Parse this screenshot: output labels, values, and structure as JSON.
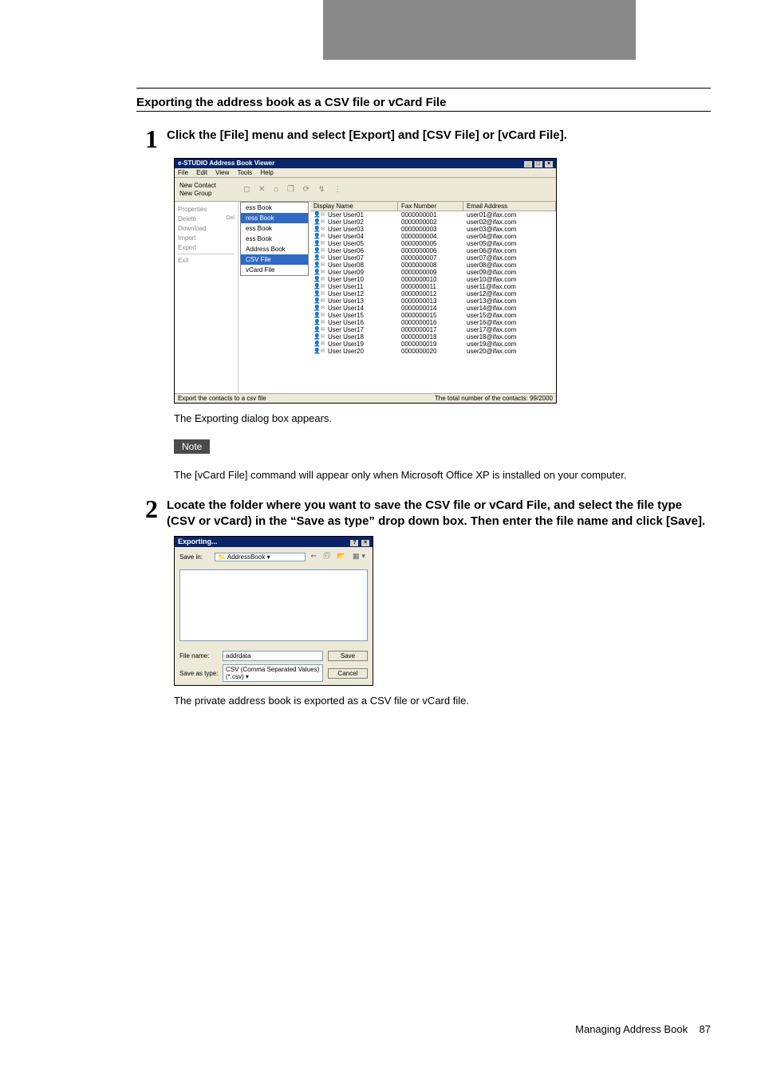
{
  "section_title": "Exporting the address book as a CSV file or vCard File",
  "steps": {
    "s1": {
      "num": "1",
      "text": "Click the [File] menu and select [Export] and [CSV File] or [vCard File]."
    },
    "s2": {
      "num": "2",
      "text": "Locate the folder where you want to save the CSV file or vCard File, and select the file type (CSV or vCard) in the “Save as type” drop down box. Then enter the file name and click [Save]."
    }
  },
  "caption1": "The Exporting dialog box appears.",
  "note_label": "Note",
  "note_text": "The [vCard File] command will appear only when Microsoft Office XP is installed on your computer.",
  "caption2": "The private address book is exported as a CSV file or vCard file.",
  "footer": {
    "title": "Managing Address Book",
    "page": "87"
  },
  "abviewer": {
    "title": "e-STUDIO Address Book Viewer",
    "menu": [
      "File",
      "Edit",
      "View",
      "Tools",
      "Help"
    ],
    "sidebuttons": [
      "New Contact",
      "New Group"
    ],
    "filemenu": {
      "items": [
        "Properties",
        "Delete",
        "Download",
        "Import",
        "Export"
      ],
      "exit": "Exit",
      "del_shortcut": "Del",
      "submenu1": [
        "ess Book",
        "ress Book",
        "ess Book",
        "ess Book",
        "Address Book",
        "CSV File",
        "vCard File"
      ],
      "submenu1_hl_index": 5
    },
    "listhead": {
      "dn": "Display Name",
      "fax": "Fax Number",
      "em": "Email Address"
    },
    "rows": [
      {
        "dn": "User User01",
        "fax": "0000000001",
        "em": "user01@ifax.com"
      },
      {
        "dn": "User User02",
        "fax": "0000000002",
        "em": "user02@ifax.com"
      },
      {
        "dn": "User User03",
        "fax": "0000000003",
        "em": "user03@ifax.com"
      },
      {
        "dn": "User User04",
        "fax": "0000000004",
        "em": "user04@ifax.com"
      },
      {
        "dn": "User User05",
        "fax": "0000000005",
        "em": "user05@ifax.com"
      },
      {
        "dn": "User User06",
        "fax": "0000000006",
        "em": "user06@ifax.com"
      },
      {
        "dn": "User User07",
        "fax": "0000000007",
        "em": "user07@ifax.com"
      },
      {
        "dn": "User User08",
        "fax": "0000000008",
        "em": "user08@ifax.com"
      },
      {
        "dn": "User User09",
        "fax": "0000000009",
        "em": "user09@ifax.com"
      },
      {
        "dn": "User User10",
        "fax": "0000000010",
        "em": "user10@ifax.com"
      },
      {
        "dn": "User User11",
        "fax": "0000000011",
        "em": "user11@ifax.com"
      },
      {
        "dn": "User User12",
        "fax": "0000000012",
        "em": "user12@ifax.com"
      },
      {
        "dn": "User User13",
        "fax": "0000000013",
        "em": "user13@ifax.com"
      },
      {
        "dn": "User User14",
        "fax": "0000000014",
        "em": "user14@ifax.com"
      },
      {
        "dn": "User User15",
        "fax": "0000000015",
        "em": "user15@ifax.com"
      },
      {
        "dn": "User User16",
        "fax": "0000000016",
        "em": "user16@ifax.com"
      },
      {
        "dn": "User User17",
        "fax": "0000000017",
        "em": "user17@ifax.com"
      },
      {
        "dn": "User User18",
        "fax": "0000000018",
        "em": "user18@ifax.com"
      },
      {
        "dn": "User User19",
        "fax": "0000000019",
        "em": "user19@ifax.com"
      },
      {
        "dn": "User User20",
        "fax": "0000000020",
        "em": "user20@ifax.com"
      }
    ],
    "status_left": "Export the contacts to a csv file",
    "status_right": "The total number of the contacts: 99/2000"
  },
  "exportdlg": {
    "title": "Exporting...",
    "savein_label": "Save in:",
    "savein_value": "AddressBook",
    "filename_label": "File name:",
    "filename_value": "addrdata",
    "saveastype_label": "Save as type:",
    "saveastype_value": "CSV (Comma Separated Values) (*.csv)",
    "btn_save": "Save",
    "btn_cancel": "Cancel"
  }
}
